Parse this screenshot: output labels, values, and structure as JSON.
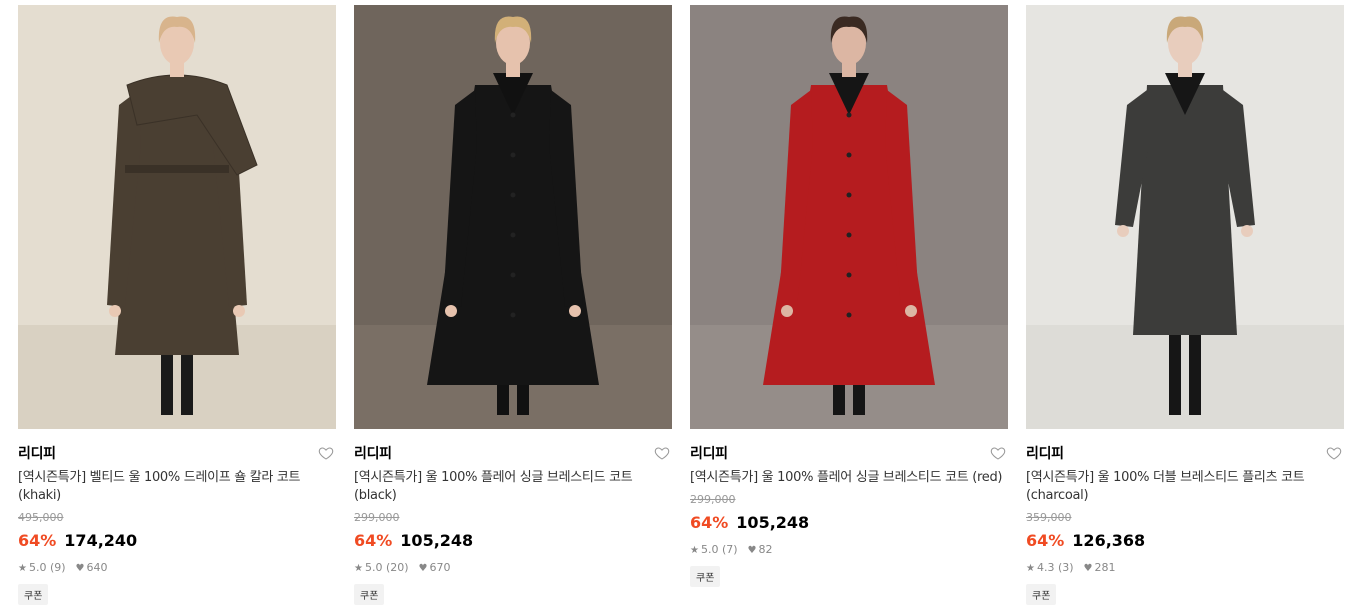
{
  "products": [
    {
      "brand": "리디피",
      "name": "[역시즌특가] 벨티드 울 100% 드레이프 숄 칼라 코트 (khaki)",
      "original_price": "495,000",
      "discount": "64%",
      "price": "174,240",
      "rating": "5.0 (9)",
      "likes": "640",
      "coupon": "쿠폰",
      "colors": {
        "bg": "#e4ddd0",
        "floor": "#d9d1c2",
        "coat": "#4a3f32",
        "skin": "#e9c9b4",
        "hair": "#d8b48c",
        "under": "#1a1a1a"
      }
    },
    {
      "brand": "리디피",
      "name": "[역시즌특가] 울 100% 플레어 싱글 브레스티드 코트 (black)",
      "original_price": "299,000",
      "discount": "64%",
      "price": "105,248",
      "rating": "5.0 (20)",
      "likes": "670",
      "coupon": "쿠폰",
      "colors": {
        "bg": "#6f655c",
        "floor": "#7a6f65",
        "coat": "#151515",
        "skin": "#e6c2ad",
        "hair": "#d2b078",
        "under": "#111111"
      }
    },
    {
      "brand": "리디피",
      "name": "[역시즌특가] 울 100% 플레어 싱글 브레스티드 코트 (red)",
      "original_price": "299,000",
      "discount": "64%",
      "price": "105,248",
      "rating": "5.0 (7)",
      "likes": "82",
      "coupon": "쿠폰",
      "colors": {
        "bg": "#8b8380",
        "floor": "#958d89",
        "coat": "#b51c1f",
        "skin": "#dcb6a3",
        "hair": "#3a2a22",
        "under": "#151515"
      }
    },
    {
      "brand": "리디피",
      "name": "[역시즌특가] 울 100% 더블 브레스티드 플리츠 코트 (charcoal)",
      "original_price": "359,000",
      "discount": "64%",
      "price": "126,368",
      "rating": "4.3 (3)",
      "likes": "281",
      "coupon": "쿠폰",
      "colors": {
        "bg": "#e6e5e1",
        "floor": "#dddcd7",
        "coat": "#3c3c3a",
        "skin": "#e8cdbd",
        "hair": "#c9a879",
        "under": "#161616"
      }
    }
  ]
}
